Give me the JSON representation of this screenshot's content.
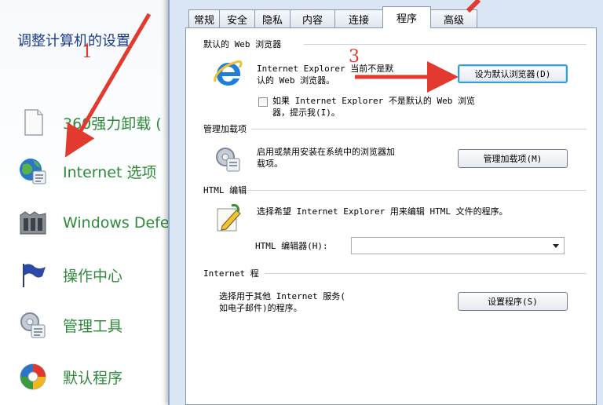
{
  "control_panel": {
    "heading": "调整计算机的设置",
    "items": [
      {
        "label": "360强力卸载 (",
        "icon": "document-icon"
      },
      {
        "label": "Internet 选项",
        "icon": "internet-options-icon"
      },
      {
        "label": "Windows Defe",
        "icon": "windows-defender-icon"
      },
      {
        "label": "操作中心",
        "icon": "action-center-flag-icon"
      },
      {
        "label": "管理工具",
        "icon": "admin-tools-icon"
      },
      {
        "label": "默认程序",
        "icon": "default-programs-icon"
      }
    ]
  },
  "dialog": {
    "tabs": [
      "常规",
      "安全",
      "隐私",
      "内容",
      "连接",
      "程序",
      "高级"
    ],
    "active_tab": "程序",
    "web_browser": {
      "title": "默认的 Web 浏览器",
      "desc_line1": "Internet Explorer 当前不是默",
      "desc_line2": "认的 Web 浏览器。",
      "button": "设为默认浏览器(D)",
      "checkbox_line1": "如果 Internet Explorer 不是默认的 Web 浏览",
      "checkbox_line2": "器，提示我(I)。"
    },
    "addons": {
      "title": "管理加载项",
      "desc_line1": "启用或禁用安装在系统中的浏览器加",
      "desc_line2": "载项。",
      "button": "管理加载项(M)"
    },
    "html_editing": {
      "title": "HTML 编辑",
      "desc": "选择希望 Internet Explorer 用来编辑 HTML 文件的程序。",
      "editor_label": "HTML 编辑器(H):",
      "editor_value": ""
    },
    "internet_programs": {
      "title": "Internet 程",
      "desc_line1": "选择用于其他 Internet 服务(",
      "desc_line2": "如电子邮件)的程序。",
      "button": "设置程序(S)"
    }
  },
  "annotations": {
    "step1": "1",
    "step3": "3",
    "color": "#e33a30"
  }
}
